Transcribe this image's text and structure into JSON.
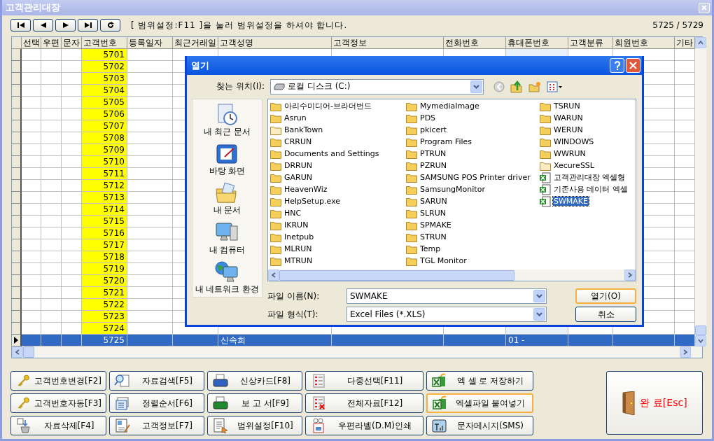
{
  "window": {
    "title": "고객관리대장"
  },
  "toolbar": {
    "nav_buttons": [
      {
        "kind": "first"
      },
      {
        "kind": "prev"
      },
      {
        "kind": "next"
      },
      {
        "kind": "last"
      },
      {
        "kind": "refresh"
      }
    ],
    "message": "[ 범위설정:F11 ]을 눌러 범위설정을 하셔야 합니다.",
    "record_count": "5725 / 5729"
  },
  "grid": {
    "columns": [
      {
        "label": "선택",
        "kind": "plain"
      },
      {
        "label": "우편",
        "kind": "plain"
      },
      {
        "label": "문자",
        "kind": "plain"
      },
      {
        "label": "고객번호",
        "kind": "number"
      },
      {
        "label": "등록일자",
        "kind": "plain"
      },
      {
        "label": "최근거래일",
        "kind": "plain"
      },
      {
        "label": "고객성명",
        "kind": "name"
      },
      {
        "label": "고객정보",
        "kind": "plain"
      },
      {
        "label": "전화번호",
        "kind": "plain"
      },
      {
        "label": "휴대폰번호",
        "kind": "mobile"
      },
      {
        "label": "고객분류",
        "kind": "plain"
      },
      {
        "label": "회원번호",
        "kind": "plain"
      },
      {
        "label": "기타",
        "kind": "plain"
      }
    ],
    "rows": [
      {
        "customer_no": "5701",
        "selected": false
      },
      {
        "customer_no": "5702",
        "selected": false
      },
      {
        "customer_no": "5703",
        "selected": false
      },
      {
        "customer_no": "5704",
        "selected": false
      },
      {
        "customer_no": "5705",
        "selected": false
      },
      {
        "customer_no": "5706",
        "selected": false
      },
      {
        "customer_no": "5707",
        "selected": false
      },
      {
        "customer_no": "5708",
        "selected": false
      },
      {
        "customer_no": "5709",
        "selected": false
      },
      {
        "customer_no": "5710",
        "selected": false
      },
      {
        "customer_no": "5711",
        "selected": false
      },
      {
        "customer_no": "5712",
        "selected": false
      },
      {
        "customer_no": "5713",
        "selected": false
      },
      {
        "customer_no": "5714",
        "selected": false
      },
      {
        "customer_no": "5715",
        "selected": false
      },
      {
        "customer_no": "5716",
        "selected": false
      },
      {
        "customer_no": "5717",
        "selected": false
      },
      {
        "customer_no": "5718",
        "selected": false
      },
      {
        "customer_no": "5719",
        "selected": false
      },
      {
        "customer_no": "5720",
        "selected": false
      },
      {
        "customer_no": "5721",
        "selected": false
      },
      {
        "customer_no": "5722",
        "selected": false
      },
      {
        "customer_no": "5723",
        "selected": false
      },
      {
        "customer_no": "5724",
        "selected": false
      },
      {
        "customer_no": "5725",
        "name": "신속희",
        "mobile": "01 -",
        "selected": true
      }
    ]
  },
  "open_dialog": {
    "title": "열기",
    "look_in_label": "찾는 위치(I):",
    "look_in_value": "로컬 디스크 (C:)",
    "places": [
      {
        "label": "내 최근 문서",
        "kind": "recent"
      },
      {
        "label": "바탕 화면",
        "kind": "desktop"
      },
      {
        "label": "내 문서",
        "kind": "documents"
      },
      {
        "label": "내 컴퓨터",
        "kind": "computer"
      },
      {
        "label": "내 네트워크 환경",
        "kind": "network"
      }
    ],
    "files": [
      {
        "name": "아리수미디어-브라더번드",
        "kind": "folder",
        "selected": false
      },
      {
        "name": "Asrun",
        "kind": "folder",
        "selected": false
      },
      {
        "name": "BankTown",
        "kind": "hidden_folder",
        "selected": false
      },
      {
        "name": "CRRUN",
        "kind": "folder",
        "selected": false
      },
      {
        "name": "Documents and Settings",
        "kind": "folder",
        "selected": false
      },
      {
        "name": "DRRUN",
        "kind": "folder",
        "selected": false
      },
      {
        "name": "GARUN",
        "kind": "folder",
        "selected": false
      },
      {
        "name": "HeavenWiz",
        "kind": "folder",
        "selected": false
      },
      {
        "name": "HelpSetup.exe",
        "kind": "folder",
        "selected": false
      },
      {
        "name": "HNC",
        "kind": "folder",
        "selected": false
      },
      {
        "name": "IKRUN",
        "kind": "folder",
        "selected": false
      },
      {
        "name": "Inetpub",
        "kind": "folder",
        "selected": false
      },
      {
        "name": "MLRUN",
        "kind": "folder",
        "selected": false
      },
      {
        "name": "MTRUN",
        "kind": "folder",
        "selected": false
      },
      {
        "name": "MymediaImage",
        "kind": "folder",
        "selected": false
      },
      {
        "name": "PDS",
        "kind": "folder",
        "selected": false
      },
      {
        "name": "pkicert",
        "kind": "folder",
        "selected": false
      },
      {
        "name": "Program Files",
        "kind": "folder",
        "selected": false
      },
      {
        "name": "PTRUN",
        "kind": "folder",
        "selected": false
      },
      {
        "name": "PZRUN",
        "kind": "folder",
        "selected": false
      },
      {
        "name": "SAMSUNG POS Printer driver",
        "kind": "folder",
        "selected": false
      },
      {
        "name": "SamsungMonitor",
        "kind": "folder",
        "selected": false
      },
      {
        "name": "SARUN",
        "kind": "folder",
        "selected": false
      },
      {
        "name": "SLRUN",
        "kind": "folder",
        "selected": false
      },
      {
        "name": "SPMAKE",
        "kind": "folder",
        "selected": false
      },
      {
        "name": "STRUN",
        "kind": "folder",
        "selected": false
      },
      {
        "name": "Temp",
        "kind": "folder",
        "selected": false
      },
      {
        "name": "TGL Monitor",
        "kind": "folder",
        "selected": false
      },
      {
        "name": "TSRUN",
        "kind": "folder",
        "selected": false
      },
      {
        "name": "WARUN",
        "kind": "folder",
        "selected": false
      },
      {
        "name": "WERUN",
        "kind": "folder",
        "selected": false
      },
      {
        "name": "WINDOWS",
        "kind": "folder",
        "selected": false
      },
      {
        "name": "WWRUN",
        "kind": "folder",
        "selected": false
      },
      {
        "name": "XecureSSL",
        "kind": "hidden_folder",
        "selected": false
      },
      {
        "name": "고객관리대장 엑셀형",
        "kind": "spreadsheet",
        "selected": false
      },
      {
        "name": "기존사용 데이터 엑셀",
        "kind": "spreadsheet",
        "selected": false
      },
      {
        "name": "SWMAKE",
        "kind": "spreadsheet",
        "selected": true
      }
    ],
    "file_name_label": "파일 이름(N):",
    "file_name_value": "SWMAKE",
    "file_type_label": "파일 형식(T):",
    "file_type_value": "Excel Files (*.XLS)",
    "buttons": [
      {
        "label": "열기(O)",
        "focused": true
      },
      {
        "label": "취소",
        "focused": false
      }
    ]
  },
  "actions": [
    {
      "label": "고객번호변경[F2]",
      "kind": "key",
      "focused": false
    },
    {
      "label": "자료검색[F5]",
      "kind": "search",
      "focused": false
    },
    {
      "label": "신상카드[F8]",
      "kind": "printer_blue",
      "focused": false
    },
    {
      "label": "다중선택[F11]",
      "kind": "checklist",
      "focused": false
    },
    {
      "label": "엑 셀 로 저장하기",
      "kind": "excel",
      "focused": false
    },
    {
      "label": "고객번호자동[F3]",
      "kind": "key",
      "focused": false
    },
    {
      "label": "정렬순서[F6]",
      "kind": "stack",
      "focused": false
    },
    {
      "label": "보 고 서[F9]",
      "kind": "printer_green",
      "focused": false
    },
    {
      "label": "전체자료[F12]",
      "kind": "checklist_x",
      "focused": false
    },
    {
      "label": "엑셀파일 붙여넣기",
      "kind": "excel",
      "focused": true
    },
    {
      "label": "자료삭제[F4]",
      "kind": "delete",
      "focused": false
    },
    {
      "label": "고객정보[F7]",
      "kind": "card",
      "focused": false
    },
    {
      "label": "범위설정[F10]",
      "kind": "document",
      "focused": false
    },
    {
      "label": "우편라벨(D.M)인쇄",
      "kind": "stamp",
      "focused": false
    },
    {
      "label": "문자메시지(SMS)",
      "kind": "signal",
      "focused": false
    }
  ],
  "exit_button": {
    "label": "완 료[Esc]"
  }
}
